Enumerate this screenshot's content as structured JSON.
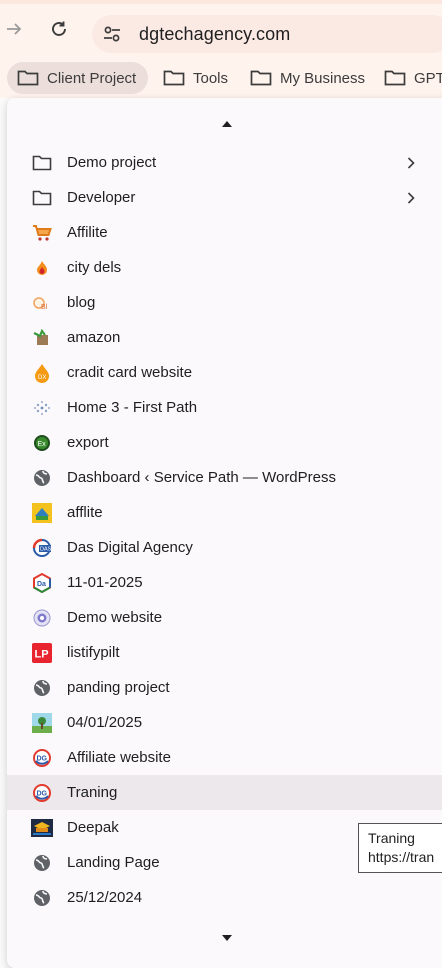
{
  "browser": {
    "url": "dgtechagency.com"
  },
  "bookmarks": [
    {
      "label": "Client Project",
      "active": true
    },
    {
      "label": "Tools"
    },
    {
      "label": "My Business"
    },
    {
      "label": "GPT"
    }
  ],
  "menu": {
    "items": [
      {
        "label": "Demo project",
        "icon": "folder-icon",
        "submenu": true
      },
      {
        "label": "Developer",
        "icon": "folder-icon",
        "submenu": true
      },
      {
        "label": "Affilite",
        "icon": "shopping-cart-favicon"
      },
      {
        "label": "city dels",
        "icon": "flame-favicon"
      },
      {
        "label": "blog",
        "icon": "blog-favicon"
      },
      {
        "label": "amazon",
        "icon": "amazon-favicon"
      },
      {
        "label": "cradit card website",
        "icon": "orange-drop-favicon"
      },
      {
        "label": "Home 3 - First Path",
        "icon": "dots-globe-favicon"
      },
      {
        "label": "export",
        "icon": "green-circle-favicon"
      },
      {
        "label": "Dashboard ‹ Service Path — WordPress",
        "icon": "globe-icon"
      },
      {
        "label": "afflite",
        "icon": "afflite-favicon"
      },
      {
        "label": "Das Digital Agency",
        "icon": "das-favicon"
      },
      {
        "label": "11-01-2025",
        "icon": "da-hexagon-favicon"
      },
      {
        "label": "Demo website",
        "icon": "purple-circle-favicon"
      },
      {
        "label": "listifypilt",
        "icon": "lp-favicon"
      },
      {
        "label": "panding project",
        "icon": "globe-icon"
      },
      {
        "label": "04/01/2025",
        "icon": "landscape-favicon"
      },
      {
        "label": "Affiliate website",
        "icon": "dg-favicon"
      },
      {
        "label": "Traning",
        "icon": "dg-favicon",
        "hovered": true
      },
      {
        "label": "Deepak",
        "icon": "graduation-favicon"
      },
      {
        "label": "Landing Page",
        "icon": "globe-icon"
      },
      {
        "label": "25/12/2024",
        "icon": "globe-icon"
      }
    ]
  },
  "tooltip": {
    "title": "Traning",
    "url": "https://tran"
  },
  "colors": {
    "chrome_bg": "#fff3ee",
    "omnibox_bg": "#fbe9e4",
    "menu_bg": "#fbf9fc",
    "hover_bg": "#ece8ec"
  }
}
